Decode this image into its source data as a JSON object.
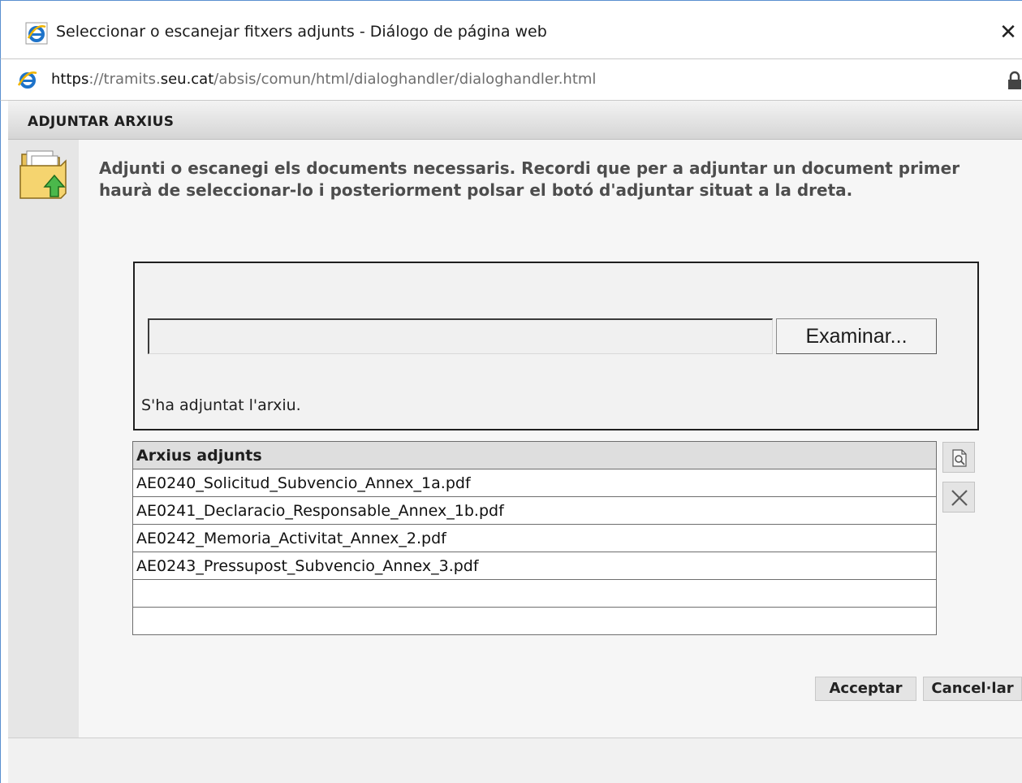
{
  "window": {
    "title": "Seleccionar o escanejar fitxers adjunts - Diálogo de página web",
    "close_glyph": "✕"
  },
  "address": {
    "scheme": "https",
    "part1": "://tramits.",
    "domain": "seu.cat",
    "path": "/absis/comun/html/dialoghandler/dialoghandler.html"
  },
  "dialog": {
    "header": "ADJUNTAR ARXIUS",
    "instructions": "Adjunti o escanegi els documents necessaris. Recordi que per a adjuntar un document primer haurà de seleccionar-lo i posteriorment polsar el botó d'adjuntar situat a la dreta.",
    "upload": {
      "file_value": "",
      "browse_label": "Examinar...",
      "status": "S'ha adjuntat l'arxiu."
    },
    "table": {
      "header": "Arxius adjunts",
      "rows": [
        "AE0240_Solicitud_Subvencio_Annex_1a.pdf",
        "AE0241_Declaracio_Responsable_Annex_1b.pdf",
        "AE0242_Memoria_Activitat_Annex_2.pdf",
        "AE0243_Pressupost_Subvencio_Annex_3.pdf",
        "",
        ""
      ]
    },
    "tools": {
      "view_icon": "preview-icon",
      "delete_icon": "delete-icon"
    },
    "accept_label": "Acceptar",
    "cancel_label": "Cancel·lar"
  },
  "colors": {
    "window_border": "#5a8fd0",
    "header_gradient_top": "#f3f3f3",
    "header_gradient_bottom": "#d5d5d5",
    "sidebar": "#e6e6e6",
    "content_bg": "#f6f6f6",
    "instruction_text": "#4d4d4d"
  }
}
